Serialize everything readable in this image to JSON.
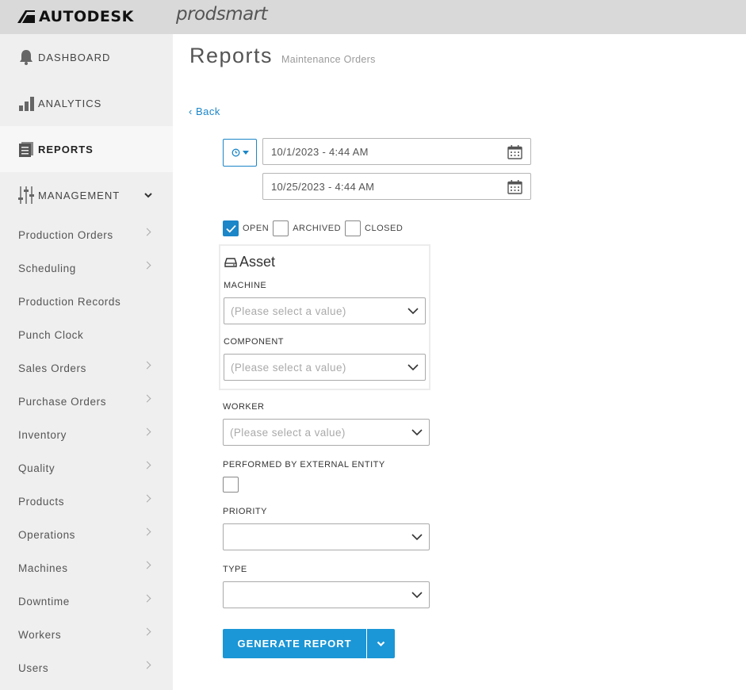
{
  "header": {
    "brand": "AUTODESK",
    "product": "prodsmart"
  },
  "sidebar": {
    "main_items": [
      {
        "label": "DASHBOARD",
        "icon": "bell-icon"
      },
      {
        "label": "ANALYTICS",
        "icon": "bar-chart-icon"
      },
      {
        "label": "REPORTS",
        "icon": "reports-icon",
        "active": true
      },
      {
        "label": "MANAGEMENT",
        "icon": "sliders-icon",
        "expanded": true
      }
    ],
    "sub_items": [
      "Production Orders",
      "Scheduling",
      "Production Records",
      "Punch Clock",
      "Sales Orders",
      "Purchase Orders",
      "Inventory",
      "Quality",
      "Products",
      "Operations",
      "Machines",
      "Downtime",
      "Workers",
      "Users"
    ]
  },
  "main": {
    "title": "Reports",
    "subtitle": "Maintenance Orders",
    "back_label": "Back",
    "date_from": "10/1/2023 - 4:44 AM",
    "date_to": "10/25/2023 - 4:44 AM",
    "status": [
      {
        "label": "OPEN",
        "checked": true
      },
      {
        "label": "ARCHIVED",
        "checked": false
      },
      {
        "label": "CLOSED",
        "checked": false
      }
    ],
    "asset": {
      "title": "Asset",
      "machine_label": "MACHINE",
      "machine_placeholder": "(Please select a value)",
      "component_label": "COMPONENT",
      "component_placeholder": "(Please select a value)"
    },
    "worker_label": "WORKER",
    "worker_placeholder": "(Please select a value)",
    "external_label": "PERFORMED BY EXTERNAL ENTITY",
    "priority_label": "PRIORITY",
    "type_label": "TYPE",
    "generate_label": "GENERATE REPORT",
    "accent_color": "#1b96d6"
  }
}
